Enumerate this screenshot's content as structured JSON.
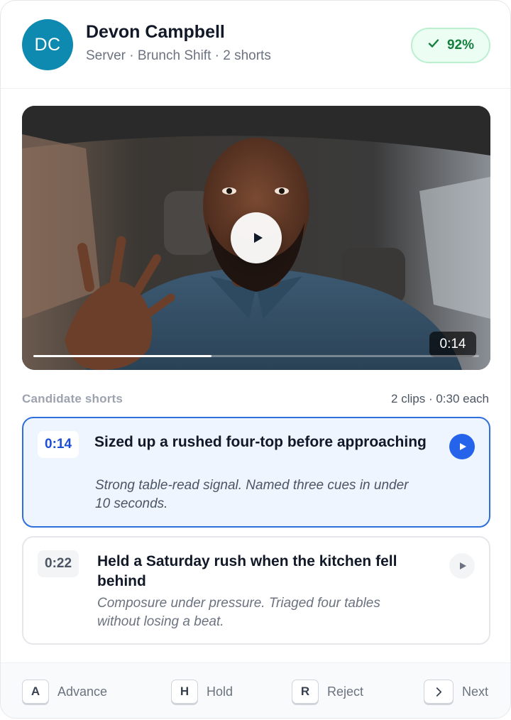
{
  "candidate": {
    "initials": "DC",
    "name": "Devon Campbell",
    "subtitle": "Server · Brunch Shift · 2 shorts",
    "score": "92%",
    "avatar_color": "#0e8ab0"
  },
  "video": {
    "current_time": "0:14",
    "progress": 0.4,
    "description": "Man in blue polo speaking inside a car, gesturing with right hand"
  },
  "shorts_section": {
    "title": "Candidate shorts",
    "meta": "2 clips · 0:30 each"
  },
  "clips": [
    {
      "timestamp": "0:14",
      "title": "Sized up a rushed four-top before approaching",
      "description": "Strong table-read signal. Named three cues in under 10 seconds.",
      "active": true
    },
    {
      "timestamp": "0:22",
      "title": "Held a Saturday rush when the kitchen fell behind",
      "description": "Composure under pressure. Triaged four tables without losing a beat.",
      "active": false
    }
  ],
  "actions": [
    {
      "key": "A",
      "label": "Advance"
    },
    {
      "key": "H",
      "label": "Hold"
    },
    {
      "key": "R",
      "label": "Reject"
    },
    {
      "key": "›",
      "label": "Next"
    }
  ],
  "colors": {
    "accent": "#2563eb",
    "success": "#15803d",
    "success_bg": "#ecfdf3"
  }
}
